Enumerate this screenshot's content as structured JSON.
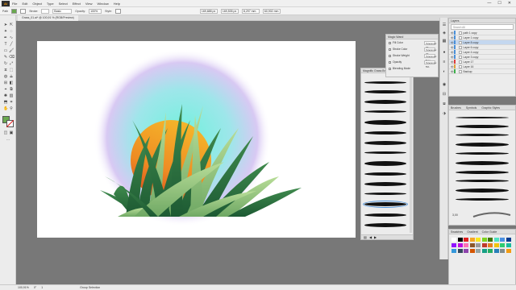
{
  "menubar": {
    "logo": "Ai",
    "items": [
      "File",
      "Edit",
      "Object",
      "Type",
      "Select",
      "Effect",
      "View",
      "Window",
      "Help"
    ],
    "window_controls": [
      "—",
      "☐",
      "✕"
    ]
  },
  "control_bar": {
    "selection": "Path",
    "stroke_label": "Stroke:",
    "brush_label": "Basic",
    "opacity_label": "Opacity:",
    "opacity_value": "100%",
    "style_label": "Style:",
    "x_value": "169,688 px",
    "y_value": "169,535 px",
    "w_value": "8,297 mm",
    "h_value": "60,902 mm"
  },
  "document_tab": "Grass_01.ai* @ 100,91 % (RGB/Preview)",
  "magic_wand": {
    "title": "Magic Wand",
    "rows": [
      {
        "label": "Fill Color",
        "value": "Tolerance: 20"
      },
      {
        "label": "Stroke Color",
        "value": "Tolerance: 20"
      },
      {
        "label": "Stroke Weight",
        "value": "Tolerance: 5 px"
      },
      {
        "label": "Opacity",
        "value": "Tolerance: 5%"
      },
      {
        "label": "Blending Mode",
        "value": ""
      }
    ]
  },
  "brush_library": {
    "title": "Magnific Grass Brush Set"
  },
  "layers": {
    "search_placeholder": "Search All",
    "rows": [
      {
        "name": "path 1 copy",
        "selected": false
      },
      {
        "name": "Layer 1 copy",
        "selected": false
      },
      {
        "name": "Layer 8 copy",
        "selected": true
      },
      {
        "name": "Layer 6 copy",
        "selected": false
      },
      {
        "name": "Layer 4 copy",
        "selected": false
      },
      {
        "name": "Layer 3 copy",
        "selected": false
      },
      {
        "name": "Layer 17",
        "selected": false
      },
      {
        "name": "Layer 16",
        "selected": false
      },
      {
        "name": "Backup",
        "selected": false
      }
    ]
  },
  "brushes": {
    "tabs": [
      "Brushes",
      "Symbols",
      "Graphic Styles"
    ],
    "size_label": "3,00"
  },
  "swatches": {
    "tabs": [
      "Swatches",
      "Gradient",
      "Color Guide"
    ]
  },
  "status_bar": {
    "zoom": "100,91%",
    "angle": "0°",
    "artboard": "1",
    "tool": "Group Selection"
  },
  "colors": {
    "accent": "#4a90d9",
    "sun_top": "#f5b22a",
    "sun_bottom": "#e25d1f",
    "glow_inner": "#7ef0e0",
    "glow_outer": "#d7c8f2",
    "grass_dark": "#1f5a34",
    "grass_light": "#9ac97a"
  }
}
